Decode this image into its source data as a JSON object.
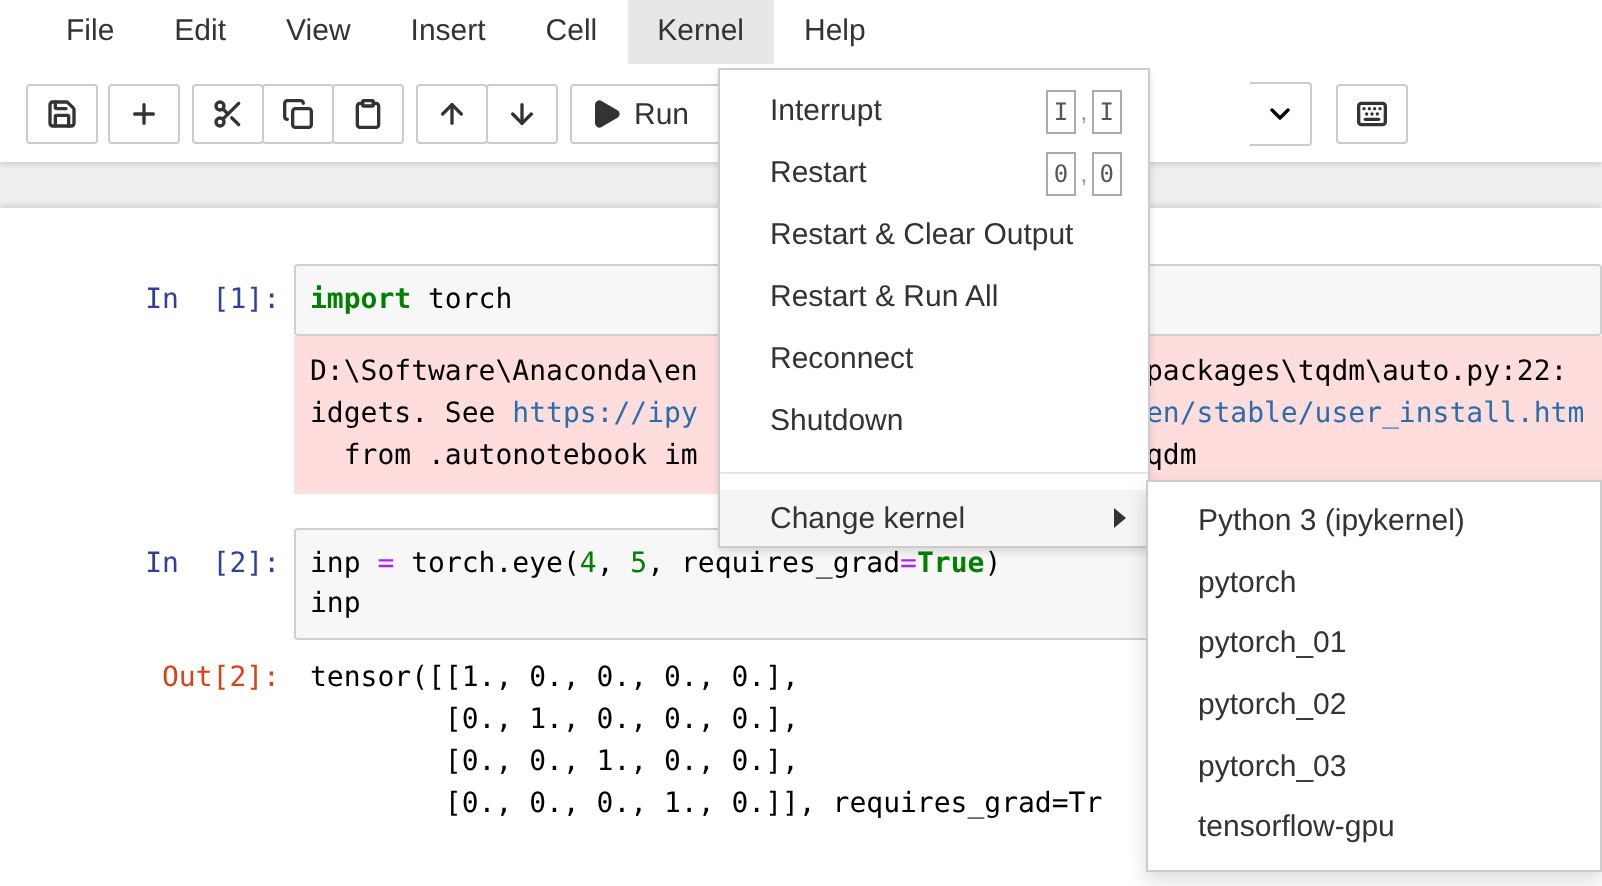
{
  "menu_bar": [
    {
      "label": "File",
      "selected": false
    },
    {
      "label": "Edit",
      "selected": false
    },
    {
      "label": "View",
      "selected": false
    },
    {
      "label": "Insert",
      "selected": false
    },
    {
      "label": "Cell",
      "selected": false
    },
    {
      "label": "Kernel",
      "selected": true
    },
    {
      "label": "Help",
      "selected": false
    }
  ],
  "toolbar": {
    "run_button": "Run"
  },
  "cells": [
    {
      "kind": "code",
      "prompt": "In  [1]:",
      "input": [
        [
          {
            "text": "import",
            "kind": "keyword"
          },
          {
            "text": " torch",
            "kind": "plain"
          }
        ]
      ],
      "output": {
        "kind": "stderr",
        "lines": [
          [
            [
              {
                "text": "D:\\Software\\Anaconda\\en",
                "kind": "text"
              }
            ],
            [
              {
                "text": "packages\\tqdm\\auto.py:22:",
                "kind": "text"
              }
            ]
          ],
          [
            [
              {
                "text": "idgets. See ",
                "kind": "text"
              },
              {
                "text": "https://ipy",
                "kind": "link"
              }
            ],
            [
              {
                "text": "en/stable/user_install.htm",
                "kind": "link"
              }
            ]
          ],
          [
            [
              {
                "text": "  from .autonotebook im",
                "kind": "text"
              }
            ],
            [
              {
                "text": "qdm",
                "kind": "text"
              }
            ]
          ]
        ]
      }
    },
    {
      "kind": "code",
      "prompt": "In  [2]:",
      "input": [
        [
          {
            "text": "inp ",
            "kind": "plain"
          },
          {
            "text": "=",
            "kind": "operator"
          },
          {
            "text": " torch.eye(",
            "kind": "plain"
          },
          {
            "text": "4",
            "kind": "number"
          },
          {
            "text": ", ",
            "kind": "plain"
          },
          {
            "text": "5",
            "kind": "number"
          },
          {
            "text": ", requires_grad",
            "kind": "plain"
          },
          {
            "text": "=",
            "kind": "operator"
          },
          {
            "text": "True",
            "kind": "keyword"
          },
          {
            "text": ")",
            "kind": "plain"
          }
        ],
        [
          {
            "text": "inp",
            "kind": "plain"
          }
        ]
      ],
      "output": {
        "kind": "result",
        "prompt": "Out[2]:",
        "lines": [
          "tensor([[1., 0., 0., 0., 0.],",
          "        [0., 1., 0., 0., 0.],",
          "        [0., 0., 1., 0., 0.],",
          "        [0., 0., 0., 1., 0.]], requires_grad=Tr"
        ]
      }
    },
    {
      "kind": "blank"
    }
  ],
  "kernel_menu": {
    "items": [
      {
        "kind": "item",
        "label": "Interrupt",
        "shortcut": {
          "keys": [
            "I",
            "I"
          ],
          "joiner": ","
        }
      },
      {
        "kind": "item",
        "label": "Restart",
        "shortcut": {
          "keys": [
            "0",
            "0"
          ],
          "joiner": ","
        }
      },
      {
        "kind": "item",
        "label": "Restart & Clear Output"
      },
      {
        "kind": "item",
        "label": "Restart & Run All"
      },
      {
        "kind": "item",
        "label": "Reconnect"
      },
      {
        "kind": "item",
        "label": "Shutdown"
      },
      {
        "kind": "divider"
      },
      {
        "kind": "submenu",
        "label": "Change kernel",
        "expanded": true
      }
    ]
  },
  "kernel_submenu": {
    "items": [
      "Python 3 (ipykernel)",
      "pytorch",
      "pytorch_01",
      "pytorch_02",
      "pytorch_03",
      "tensorflow-gpu"
    ]
  }
}
